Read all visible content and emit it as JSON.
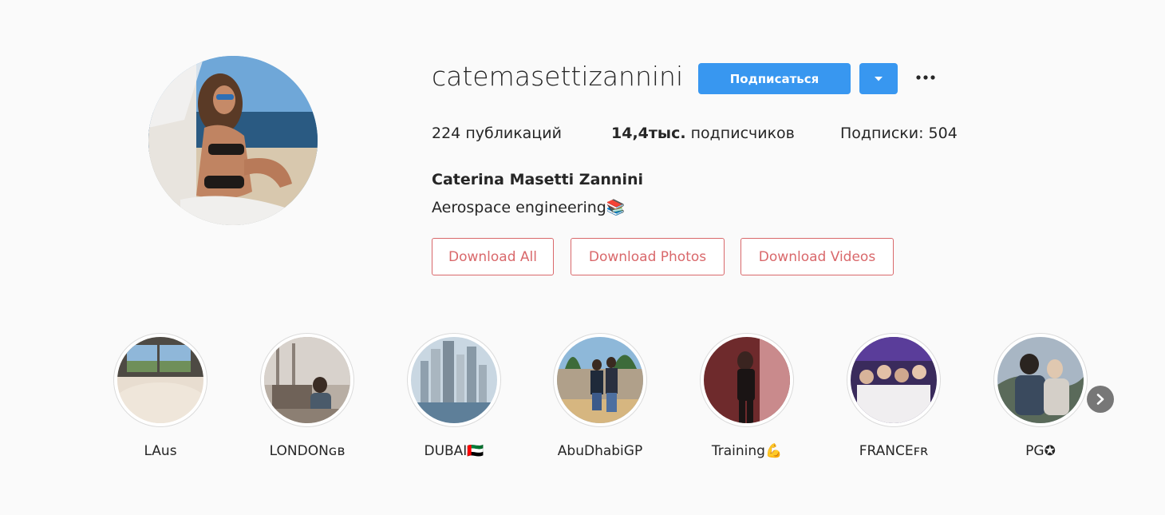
{
  "profile": {
    "username": "catemasettizannini",
    "follow_label": "Подписаться",
    "full_name": "Caterina Masetti Zannini",
    "bio": "Aerospace engineering📚",
    "stats": {
      "posts_count": "224",
      "posts_label": "публикаций",
      "followers_count": "14,4тыс.",
      "followers_label": "подписчиков",
      "following_label": "Подписки:",
      "following_count": "504"
    }
  },
  "downloads": {
    "all_label": "Download All",
    "photos_label": "Download Photos",
    "videos_label": "Download Videos"
  },
  "highlights": [
    {
      "label": "LAus"
    },
    {
      "label": "LONDONɢʙ"
    },
    {
      "label": "DUBAI🇦🇪"
    },
    {
      "label": "AbuDhabiGP"
    },
    {
      "label": "Training💪"
    },
    {
      "label": "FRANCEꜰʀ"
    },
    {
      "label": "PG✪"
    }
  ],
  "icons": {
    "dropdown": "chevron-down-icon",
    "more": "more-icon",
    "next": "chevron-right-icon"
  },
  "colors": {
    "primary": "#3897f0",
    "download_accent": "#d9686b",
    "background": "#fafafa"
  }
}
